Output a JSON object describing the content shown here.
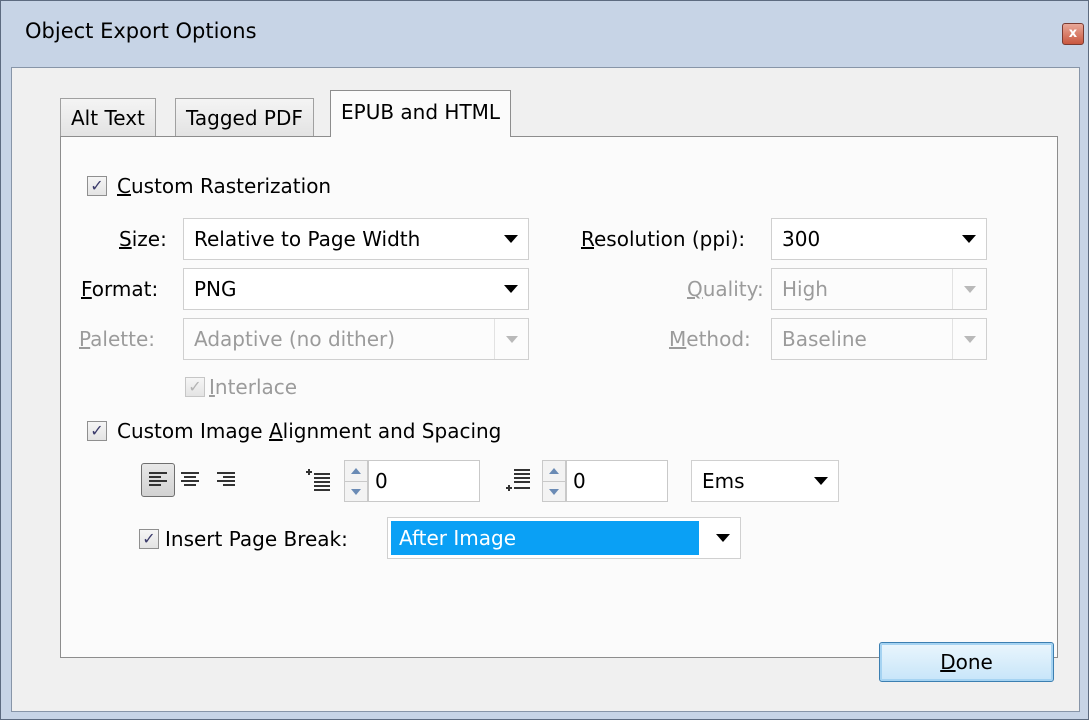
{
  "window": {
    "title": "Object Export Options",
    "close_glyph": "x"
  },
  "tabs": [
    {
      "label": "Alt Text"
    },
    {
      "label": "Tagged PDF"
    },
    {
      "label": "EPUB and HTML"
    }
  ],
  "rasterization": {
    "checkbox_label_u": "C",
    "checkbox_label_rest": "ustom Rasterization",
    "checked": true,
    "size_label_u": "S",
    "size_label_rest": "ize:",
    "size_value": "Relative to Page Width",
    "resolution_label_u": "R",
    "resolution_label_rest": "esolution (ppi):",
    "resolution_value": "300",
    "format_label_u": "F",
    "format_label_rest": "ormat:",
    "format_value": "PNG",
    "quality_label_u": "Q",
    "quality_label_rest": "uality:",
    "quality_value": "High",
    "palette_label_u": "P",
    "palette_label_rest": "alette:",
    "palette_value": "Adaptive (no dither)",
    "method_label_u": "M",
    "method_label_rest": "ethod:",
    "method_value": "Baseline",
    "interlace_label_u": "I",
    "interlace_label_rest": "nterlace",
    "interlace_checked": true
  },
  "alignment": {
    "checkbox_label_pre": "Custom Image ",
    "checkbox_label_u": "A",
    "checkbox_label_rest": "lignment and Spacing",
    "checked": true,
    "space_before_value": "0",
    "space_after_value": "0",
    "units_value": "Ems",
    "page_break_label": "Insert Page Break:",
    "page_break_checked": true,
    "page_break_value": "After Image",
    "highlight_color": "#0aa0f5"
  },
  "footer": {
    "done_u": "D",
    "done_rest": "one"
  },
  "check_glyph": "✓"
}
